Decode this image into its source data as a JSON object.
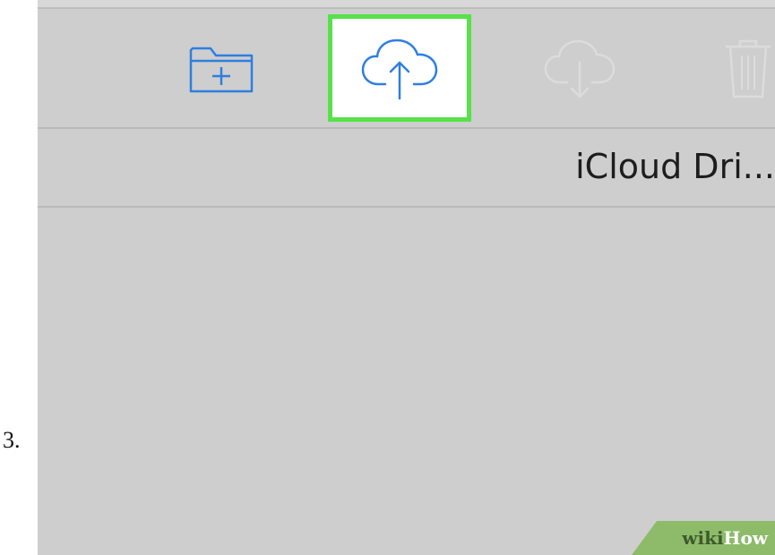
{
  "step": {
    "number": "3."
  },
  "toolbar": {
    "buttons": [
      {
        "name": "new-folder",
        "icon": "folder-plus-icon",
        "enabled": true
      },
      {
        "name": "upload",
        "icon": "cloud-upload-icon",
        "enabled": true,
        "highlighted": true
      },
      {
        "name": "download",
        "icon": "cloud-download-icon",
        "enabled": false
      },
      {
        "name": "delete",
        "icon": "trash-icon",
        "enabled": false
      }
    ]
  },
  "location": {
    "title": "iCloud Dri..."
  },
  "watermark": {
    "part1": "wiki",
    "part2": "How"
  },
  "colors": {
    "accent": "#2f7ee0",
    "highlight": "#57e14a",
    "disabled_icon": "#dcdcdc",
    "background": "#cecece",
    "watermark": "#8dbb6a"
  }
}
